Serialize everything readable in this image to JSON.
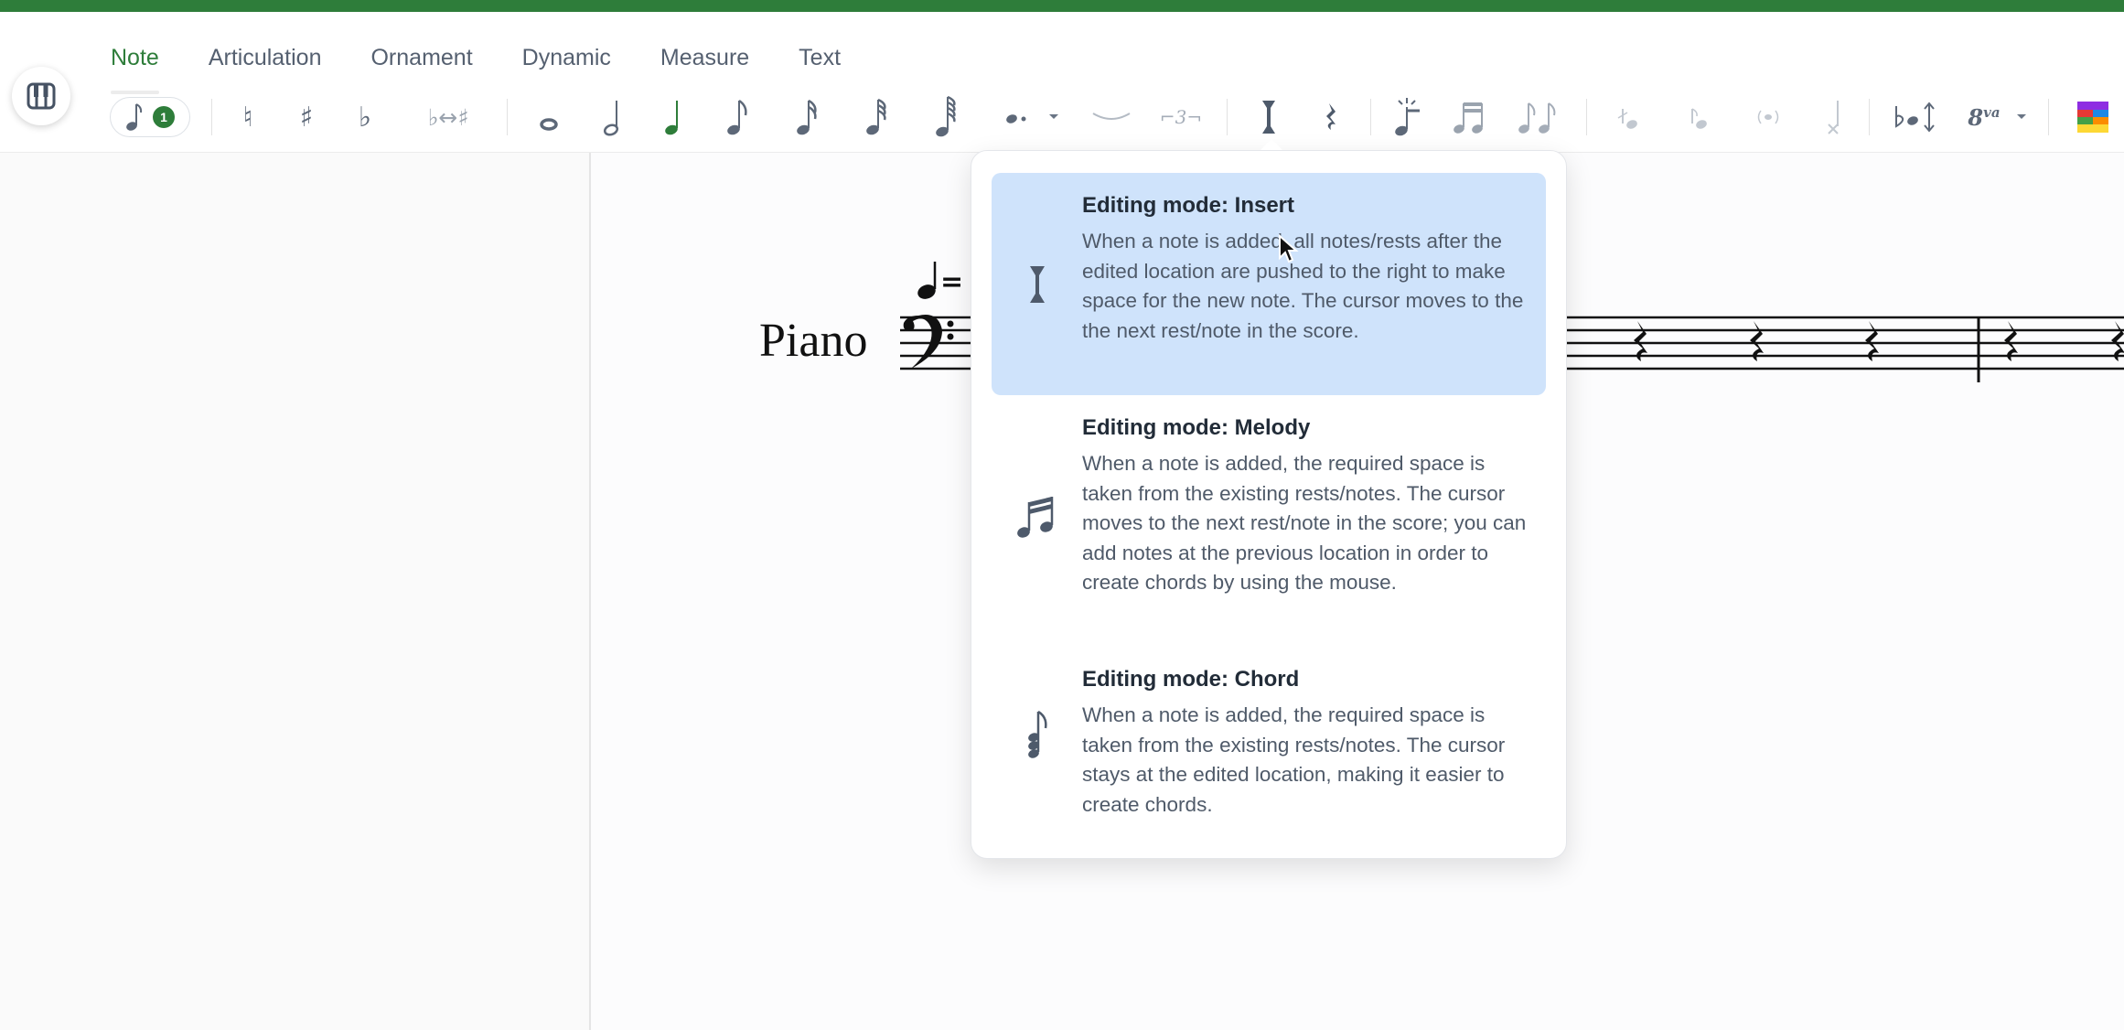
{
  "tabs": [
    {
      "label": "Note",
      "active": true
    },
    {
      "label": "Articulation",
      "active": false
    },
    {
      "label": "Ornament",
      "active": false
    },
    {
      "label": "Dynamic",
      "active": false
    },
    {
      "label": "Measure",
      "active": false
    },
    {
      "label": "Text",
      "active": false
    }
  ],
  "toolbar": {
    "voice_count": "1",
    "accidentals": {
      "natural": "♮",
      "sharp": "♯",
      "flat": "♭",
      "enharmonic": "♭↔♯"
    },
    "tuplet_label": "⌐3¬",
    "octave_label": "8",
    "octave_superscript": "va",
    "active_color": "#2e7d3a",
    "active_duration": "quarter"
  },
  "score": {
    "instrument": "Piano",
    "tempo_mark": "="
  },
  "editing_modes": [
    {
      "icon": "insert-cursor-icon",
      "title": "Editing mode: Insert",
      "description": "When a note is added, all notes/rests after the edited location are pushed to the right to make space for the new note. The cursor moves to the the next rest/note in the score.",
      "selected": true
    },
    {
      "icon": "beamed-notes-icon",
      "title": "Editing mode: Melody",
      "description": "When a note is added, the required space is taken from the existing rests/notes. The cursor moves to the next rest/note in the score; you can add notes at the previous location in order to create chords by using the mouse.",
      "selected": false
    },
    {
      "icon": "chord-icon",
      "title": "Editing mode: Chord",
      "description": "When a note is added, the required space is taken from the existing rests/notes. The cursor stays at the edited location, making it easier to create chords.",
      "selected": false
    }
  ],
  "colors": {
    "brand_green": "#2e7d3a",
    "selection_blue": "#cfe3fb",
    "icon_gray": "#6a7585"
  }
}
